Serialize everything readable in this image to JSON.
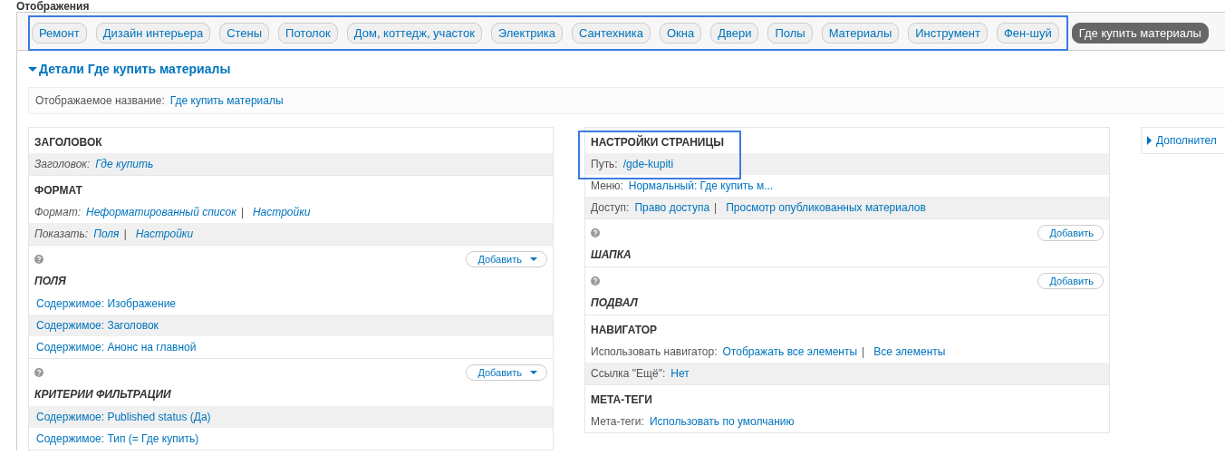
{
  "page_title": "Отображения",
  "tabs": [
    {
      "label": "Ремонт",
      "selected": false,
      "highlighted": true
    },
    {
      "label": "Дизайн интерьера",
      "selected": false,
      "highlighted": true
    },
    {
      "label": "Стены",
      "selected": false,
      "highlighted": true
    },
    {
      "label": "Потолок",
      "selected": false,
      "highlighted": true
    },
    {
      "label": "Дом, коттедж, участок",
      "selected": false,
      "highlighted": true
    },
    {
      "label": "Электрика",
      "selected": false,
      "highlighted": true
    },
    {
      "label": "Сантехника",
      "selected": false,
      "highlighted": true
    },
    {
      "label": "Окна",
      "selected": false,
      "highlighted": true
    },
    {
      "label": "Двери",
      "selected": false,
      "highlighted": true
    },
    {
      "label": "Полы",
      "selected": false,
      "highlighted": true
    },
    {
      "label": "Материалы",
      "selected": false,
      "highlighted": true
    },
    {
      "label": "Инструмент",
      "selected": false,
      "highlighted": true
    },
    {
      "label": "Фен-шуй",
      "selected": false,
      "highlighted": true
    },
    {
      "label": "Где купить материалы",
      "selected": true,
      "highlighted": false
    }
  ],
  "details": {
    "title": "Детали Где купить материалы",
    "expanded": true,
    "display_name": {
      "label": "Отображаемое название:",
      "value": "Где купить материалы"
    }
  },
  "columns": [
    {
      "sections": [
        {
          "title": "ЗАГОЛОВОК",
          "kind": "settings",
          "italic": true,
          "rows": [
            {
              "label": "Заголовок:",
              "links": [
                "Где купить"
              ],
              "striped": true
            }
          ]
        },
        {
          "title": "ФОРМАТ",
          "kind": "settings",
          "italic": true,
          "rows": [
            {
              "label": "Формат:",
              "links": [
                "Неформатированный список",
                "Настройки"
              ],
              "separator": "|",
              "striped": false
            },
            {
              "label": "Показать:",
              "links": [
                "Поля",
                "Настройки"
              ],
              "separator": "|",
              "striped": true
            }
          ]
        },
        {
          "title": "ПОЛЯ",
          "kind": "bucket",
          "add_button": {
            "label": "Добавить",
            "dropdown": true
          },
          "items": [
            {
              "text": "Содержимое: Изображение",
              "striped": false
            },
            {
              "text": "Содержимое: Заголовок",
              "striped": true
            },
            {
              "text": "Содержимое: Анонс на главной",
              "striped": false
            }
          ]
        },
        {
          "title": "КРИТЕРИИ ФИЛЬТРАЦИИ",
          "kind": "bucket",
          "add_button": {
            "label": "Добавить",
            "dropdown": true
          },
          "items": [
            {
              "text": "Содержимое: Published status (Да)",
              "striped": true
            },
            {
              "text": "Содержимое: Тип (= Где купить)",
              "striped": false
            }
          ]
        }
      ]
    },
    {
      "sections": [
        {
          "title": "НАСТРОЙКИ СТРАНИЦЫ",
          "kind": "settings",
          "italic": false,
          "highlighted": true,
          "rows": [
            {
              "label": "Путь:",
              "links": [
                "/gde-kupiti"
              ],
              "striped": true
            },
            {
              "label": "Меню:",
              "links": [
                "Нормальный: Где купить м..."
              ],
              "striped": false
            },
            {
              "label": "Доступ:",
              "links": [
                "Право доступа",
                "Просмотр опубликованных материалов"
              ],
              "separator": "|",
              "striped": true
            }
          ]
        },
        {
          "title": "ШАПКА",
          "kind": "bucket",
          "add_button": {
            "label": "Добавить",
            "dropdown": false
          }
        },
        {
          "title": "ПОДВАЛ",
          "kind": "bucket",
          "add_button": {
            "label": "Добавить",
            "dropdown": false
          }
        },
        {
          "title": "НАВИГАТОР",
          "kind": "settings",
          "italic": false,
          "rows": [
            {
              "label": "Использовать навигатор:",
              "links": [
                "Отображать все элементы",
                "Все элементы"
              ],
              "separator": "|",
              "striped": false
            },
            {
              "label": "Ссылка \"Ещё\":",
              "links": [
                "Нет"
              ],
              "striped": true
            }
          ]
        },
        {
          "title": "МЕТА-ТЕГИ",
          "kind": "settings",
          "italic": false,
          "rows": [
            {
              "label": "Мета-теги:",
              "links": [
                "Использовать по умолчанию"
              ],
              "striped": false
            }
          ]
        }
      ]
    }
  ],
  "advanced": {
    "title": "Дополнител",
    "expanded": false
  }
}
